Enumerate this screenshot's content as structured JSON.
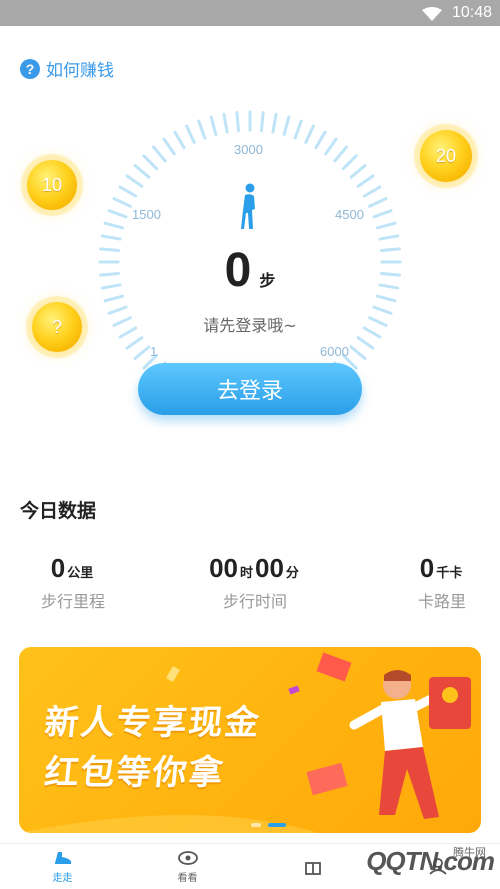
{
  "status_bar": {
    "time": "10:48"
  },
  "help": {
    "label": "如何赚钱",
    "icon": "question-circle-icon"
  },
  "coins": {
    "left_top": "10",
    "left_bottom": "?",
    "right_top": "20"
  },
  "gauge": {
    "min_label": "1",
    "labels": [
      "1500",
      "3000",
      "4500"
    ],
    "max_label": "6000",
    "min": 1,
    "max": 6000,
    "value": 0
  },
  "steps": {
    "value": "0",
    "unit": "步",
    "hint": "请先登录哦~"
  },
  "login_button": {
    "label": "去登录"
  },
  "today": {
    "title": "今日数据",
    "distance": {
      "value": "0",
      "unit": "公里",
      "label": "步行里程"
    },
    "time": {
      "hours": "00",
      "hours_unit": "时",
      "minutes": "00",
      "minutes_unit": "分",
      "label": "步行时间"
    },
    "calories": {
      "value": "0",
      "unit": "千卡",
      "label": "卡路里"
    }
  },
  "banner": {
    "line1": "新人专享现金",
    "line2": "红包等你拿"
  },
  "tabs": [
    {
      "label": "走走",
      "icon": "shoe-icon"
    },
    {
      "label": "看看",
      "icon": "eye-icon"
    },
    {
      "label": "",
      "icon": "gift-icon"
    },
    {
      "label": "",
      "icon": "user-icon"
    }
  ],
  "watermark": {
    "site": "腾牛网",
    "logo": "QQTN.com"
  },
  "colors": {
    "accent": "#2a9ee8",
    "gold": "#ffc21a"
  }
}
